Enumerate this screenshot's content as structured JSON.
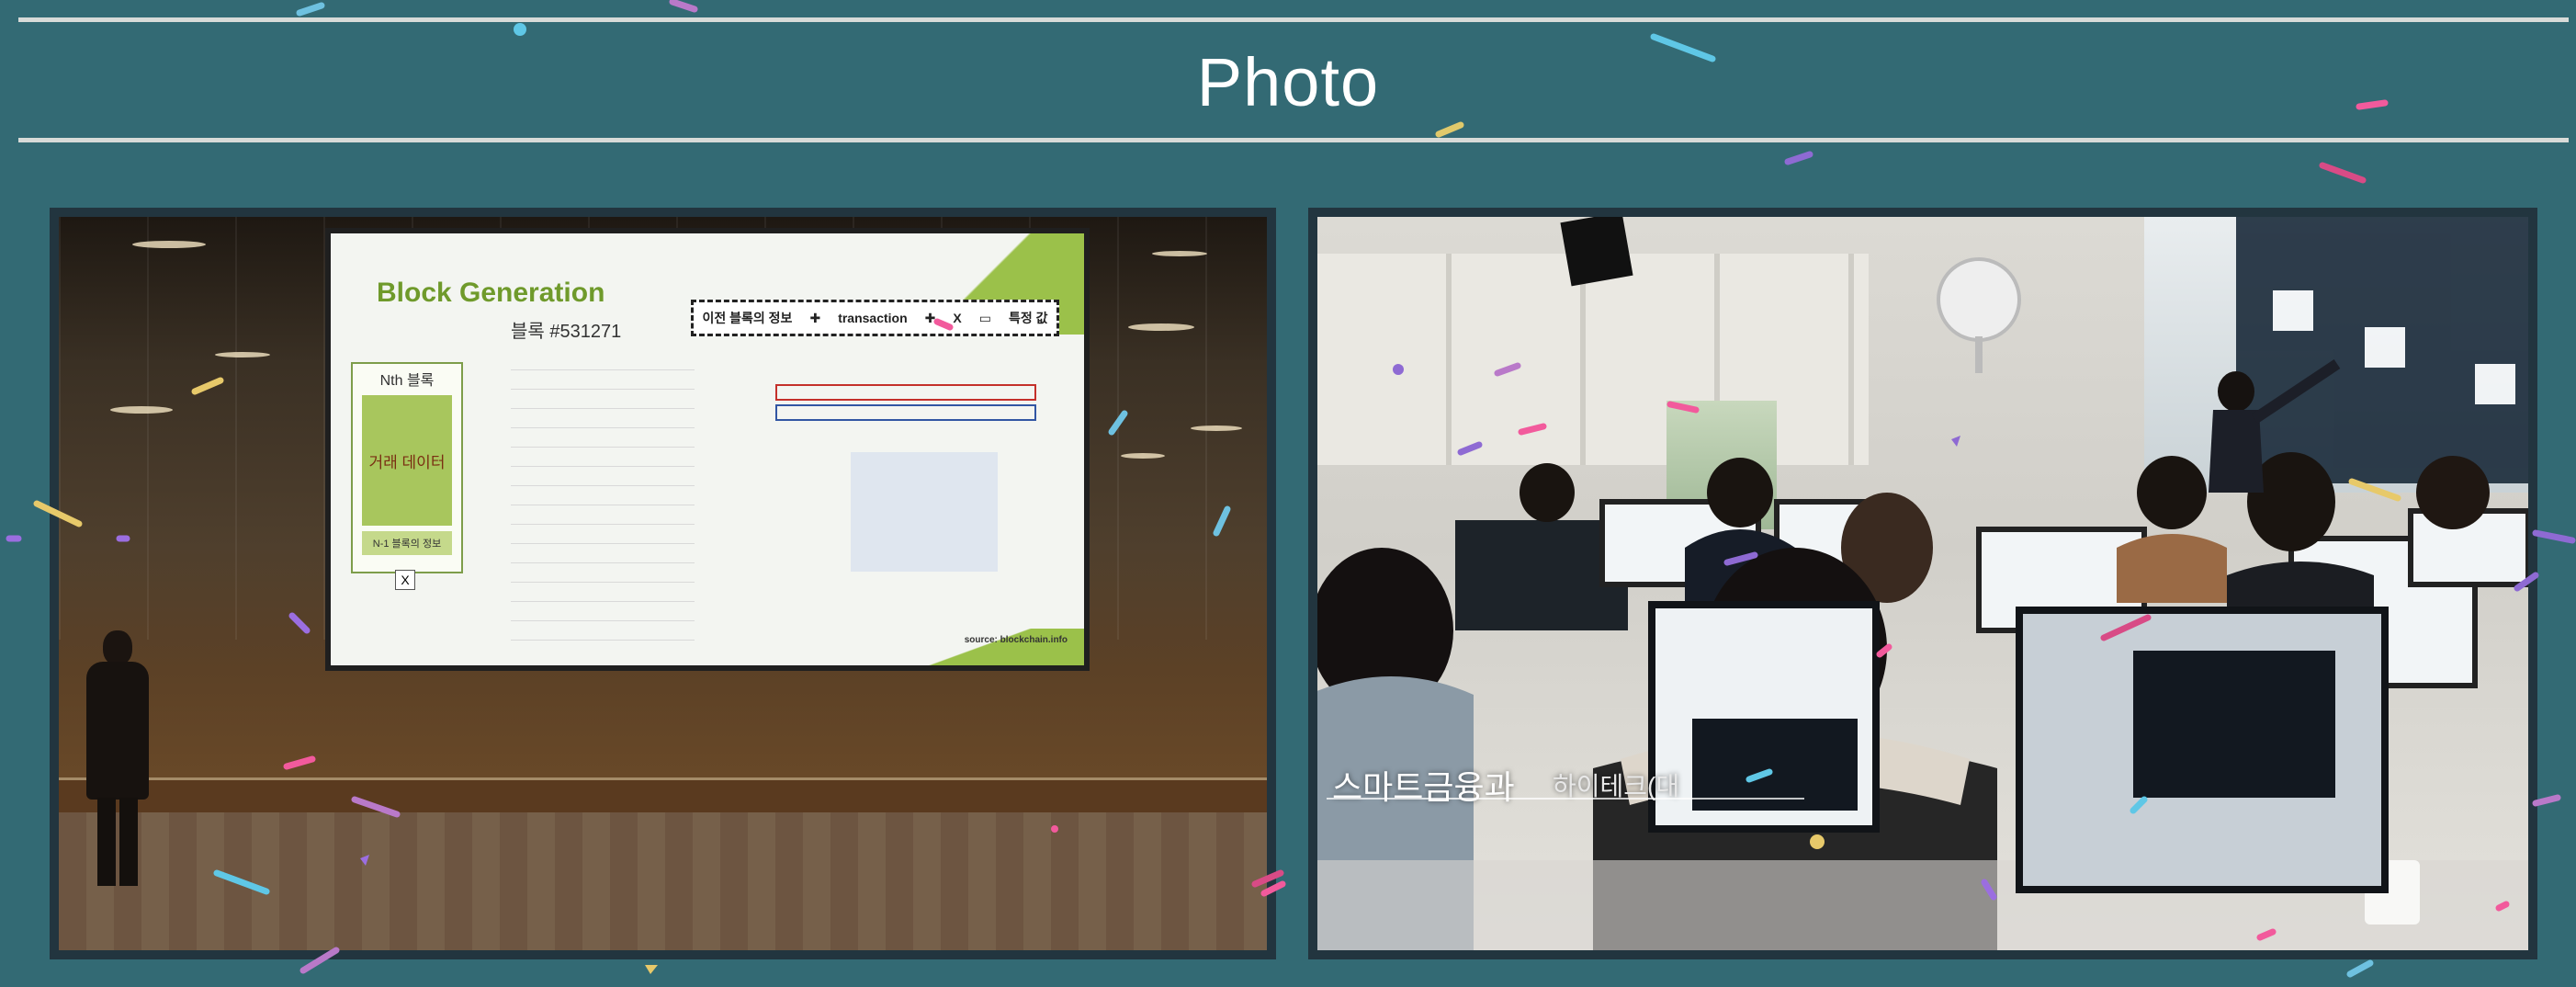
{
  "page": {
    "heading": "Photo",
    "background_color": "#336a74",
    "rule_color": "#d8dbd8"
  },
  "photos": [
    {
      "id": "auditorium-lecture",
      "slide": {
        "title": "Block Generation",
        "block_number": "블록 #531271",
        "nth_block_label": "Nth 블록",
        "tx_data_label": "거래 데이터",
        "prev_block_label": "N-1 블록의 정보",
        "x_mark": "X",
        "formula_part_1": "이전 블록의 정보",
        "formula_part_2": "transaction",
        "formula_part_3": "X",
        "formula_part_4": "특정 값",
        "source": "source: blockchain.info"
      }
    },
    {
      "id": "classroom-practice",
      "caption_main": "스마트금융과",
      "caption_sub": "하이테크(대"
    }
  ]
}
